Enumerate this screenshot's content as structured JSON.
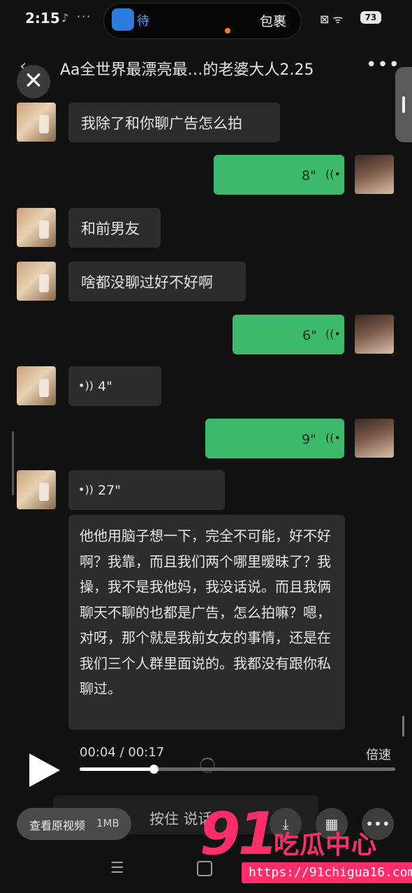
{
  "status_bar": {
    "time": "2:15",
    "app_icon": "app-icon",
    "app_text": "待",
    "island_text": "包裹",
    "right_icons": "⊠ ᯤ",
    "battery": "73"
  },
  "header": {
    "title": "Aa全世界最漂亮最…的老婆大人2.25",
    "close_glyph": "✕",
    "more_glyph": "•••"
  },
  "messages": [
    {
      "side": "in",
      "type": "text",
      "text": "我除了和你聊广告怎么拍"
    },
    {
      "side": "out",
      "type": "voice",
      "duration": "8\""
    },
    {
      "side": "in",
      "type": "text",
      "text": "和前男友"
    },
    {
      "side": "in",
      "type": "text",
      "text": "啥都没聊过好不好啊"
    },
    {
      "side": "out",
      "type": "voice",
      "duration": "6\""
    },
    {
      "side": "in",
      "type": "voice",
      "duration": "4\""
    },
    {
      "side": "out",
      "type": "voice",
      "duration": "9\""
    },
    {
      "side": "in",
      "type": "voice",
      "duration": "27\""
    }
  ],
  "voice_glyph_out": "((•",
  "voice_glyph_in": "•))",
  "transcript": "他他用脑子想一下，完全不可能，好不好啊？我靠，而且我们两个哪里暧昧了？我操，我不是我他妈，我没话说。而且我俩聊天不聊的也都是广告，怎么拍嘛？嗯，对呀，那个就是我前女友的事情，还是在我们三个人群里面说的。我都没有跟你私聊过。",
  "player": {
    "time_text": "00:04 / 00:17",
    "speed_label": "倍速",
    "progress": 0.2353
  },
  "bottom": {
    "input_placeholder": "按住 说话",
    "original_video_label": "查看原视频",
    "original_video_size": "1MB",
    "buttons": [
      "download-icon",
      "grid-icon",
      "more-icon"
    ],
    "download_glyph": "⤓",
    "grid_glyph": "▦",
    "more_glyph": "•••",
    "nav_menu_glyph": "☰"
  },
  "watermark": {
    "logo": "91",
    "name": "吃瓜中心",
    "url": "https://91chigua16.com",
    "color": "#ff2d6a"
  },
  "colors": {
    "bubble_out": "#3cb96a",
    "bubble_in": "#2c2c2c",
    "background": "#111111"
  }
}
